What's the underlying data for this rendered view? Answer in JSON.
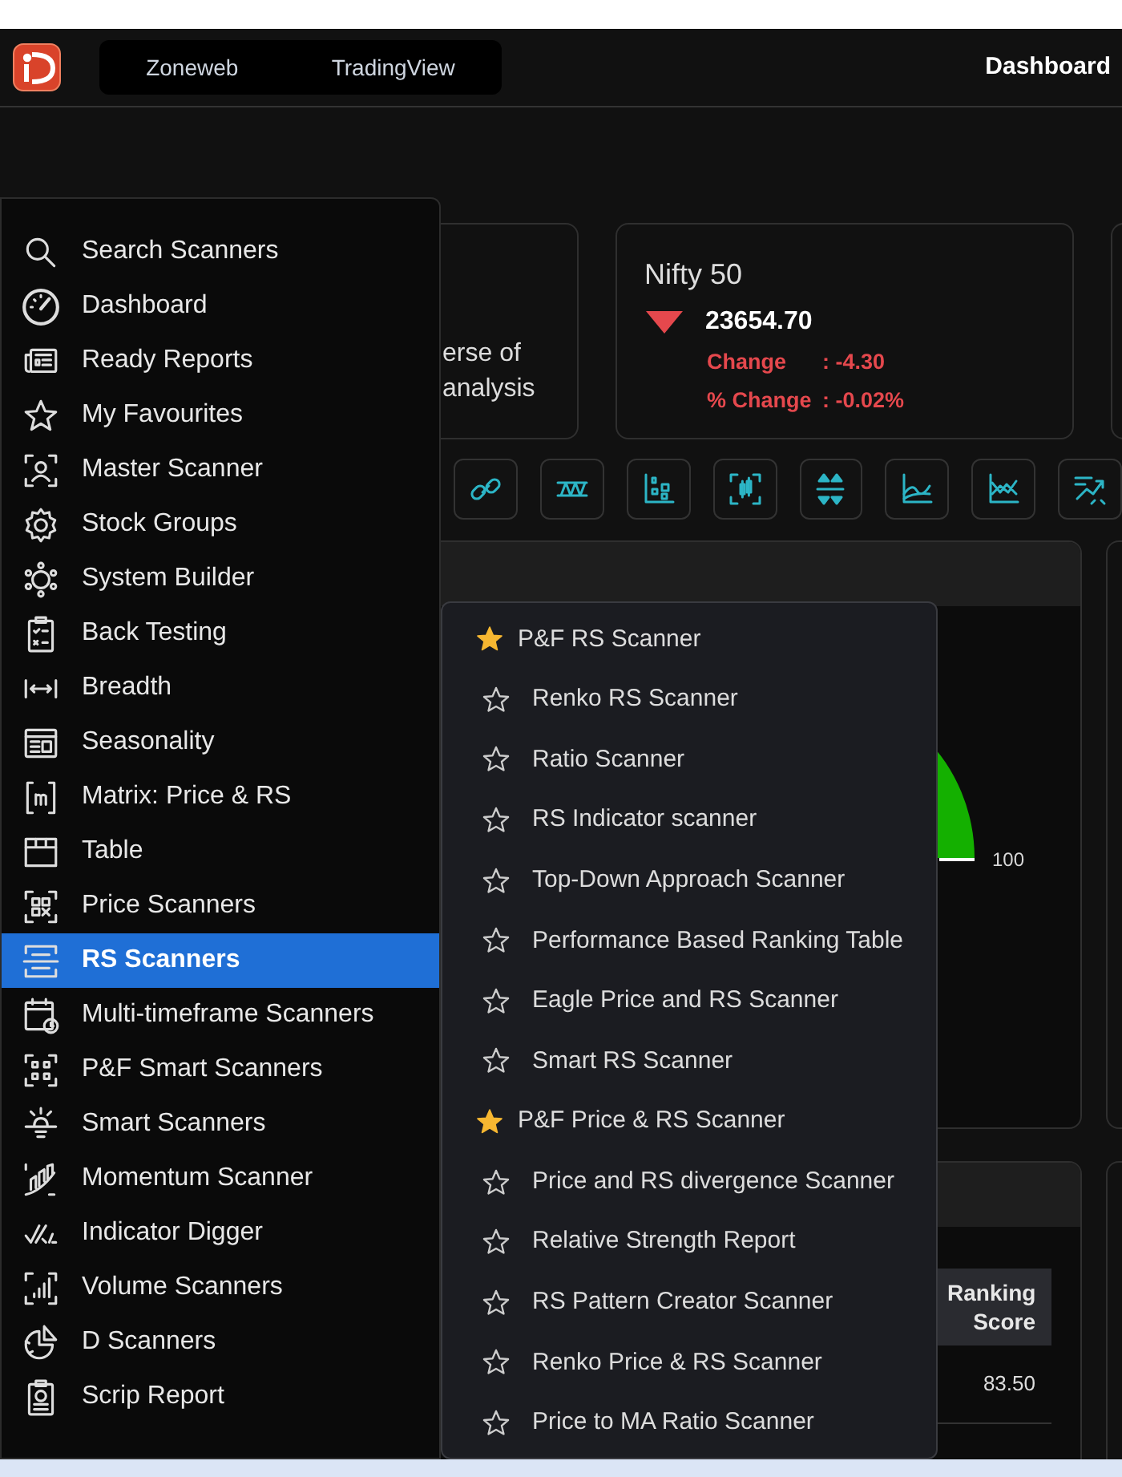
{
  "navbar": {
    "tabs": [
      {
        "label": "Zoneweb"
      },
      {
        "label": "TradingView"
      }
    ],
    "title": "Dashboard"
  },
  "cards": [
    {
      "kind": "text",
      "text": "erse of\nanalysis"
    },
    {
      "kind": "index",
      "name": "Nifty 50",
      "falling": true,
      "value": "23654.70",
      "change_label": "Change",
      "change_value": ": -4.30",
      "pct_label": "% Change",
      "pct_value": ": -0.02%"
    }
  ],
  "gauge": {
    "max_label": "100"
  },
  "table": {
    "columns": [
      "Ranking\nScore"
    ],
    "rows": [
      [
        "83.50"
      ]
    ]
  },
  "sidebar": {
    "items": [
      {
        "label": "Search Scanners",
        "selected": false
      },
      {
        "label": "Dashboard",
        "selected": false
      },
      {
        "label": "Ready Reports",
        "selected": false
      },
      {
        "label": "My Favourites",
        "selected": false
      },
      {
        "label": "Master Scanner",
        "selected": false
      },
      {
        "label": "Stock Groups",
        "selected": false
      },
      {
        "label": "System Builder",
        "selected": false
      },
      {
        "label": "Back Testing",
        "selected": false
      },
      {
        "label": "Breadth",
        "selected": false
      },
      {
        "label": "Seasonality",
        "selected": false
      },
      {
        "label": "Matrix: Price & RS",
        "selected": false
      },
      {
        "label": "Table",
        "selected": false
      },
      {
        "label": "Price Scanners",
        "selected": false
      },
      {
        "label": "RS Scanners",
        "selected": true
      },
      {
        "label": "Multi-timeframe Scanners",
        "selected": false
      },
      {
        "label": "P&F Smart Scanners",
        "selected": false
      },
      {
        "label": "Smart Scanners",
        "selected": false
      },
      {
        "label": "Momentum Scanner",
        "selected": false
      },
      {
        "label": "Indicator Digger",
        "selected": false
      },
      {
        "label": "Volume Scanners",
        "selected": false
      },
      {
        "label": "D Scanners",
        "selected": false
      },
      {
        "label": "Scrip Report",
        "selected": false
      }
    ]
  },
  "submenu": {
    "items": [
      {
        "label": "P&F RS Scanner",
        "favourite": true
      },
      {
        "label": "Renko RS Scanner",
        "favourite": false
      },
      {
        "label": "Ratio Scanner",
        "favourite": false
      },
      {
        "label": "RS Indicator scanner",
        "favourite": false
      },
      {
        "label": "Top-Down Approach Scanner",
        "favourite": false
      },
      {
        "label": "Performance Based Ranking Table",
        "favourite": false
      },
      {
        "label": "Eagle Price and RS Scanner",
        "favourite": false
      },
      {
        "label": "Smart RS Scanner",
        "favourite": false
      },
      {
        "label": "P&F Price & RS Scanner",
        "favourite": true
      },
      {
        "label": "Price and RS divergence Scanner",
        "favourite": false
      },
      {
        "label": "Relative Strength Report",
        "favourite": false
      },
      {
        "label": "RS Pattern Creator Scanner",
        "favourite": false
      },
      {
        "label": "Renko Price & RS Scanner",
        "favourite": false
      },
      {
        "label": "Price to MA Ratio Scanner",
        "favourite": false
      }
    ]
  }
}
